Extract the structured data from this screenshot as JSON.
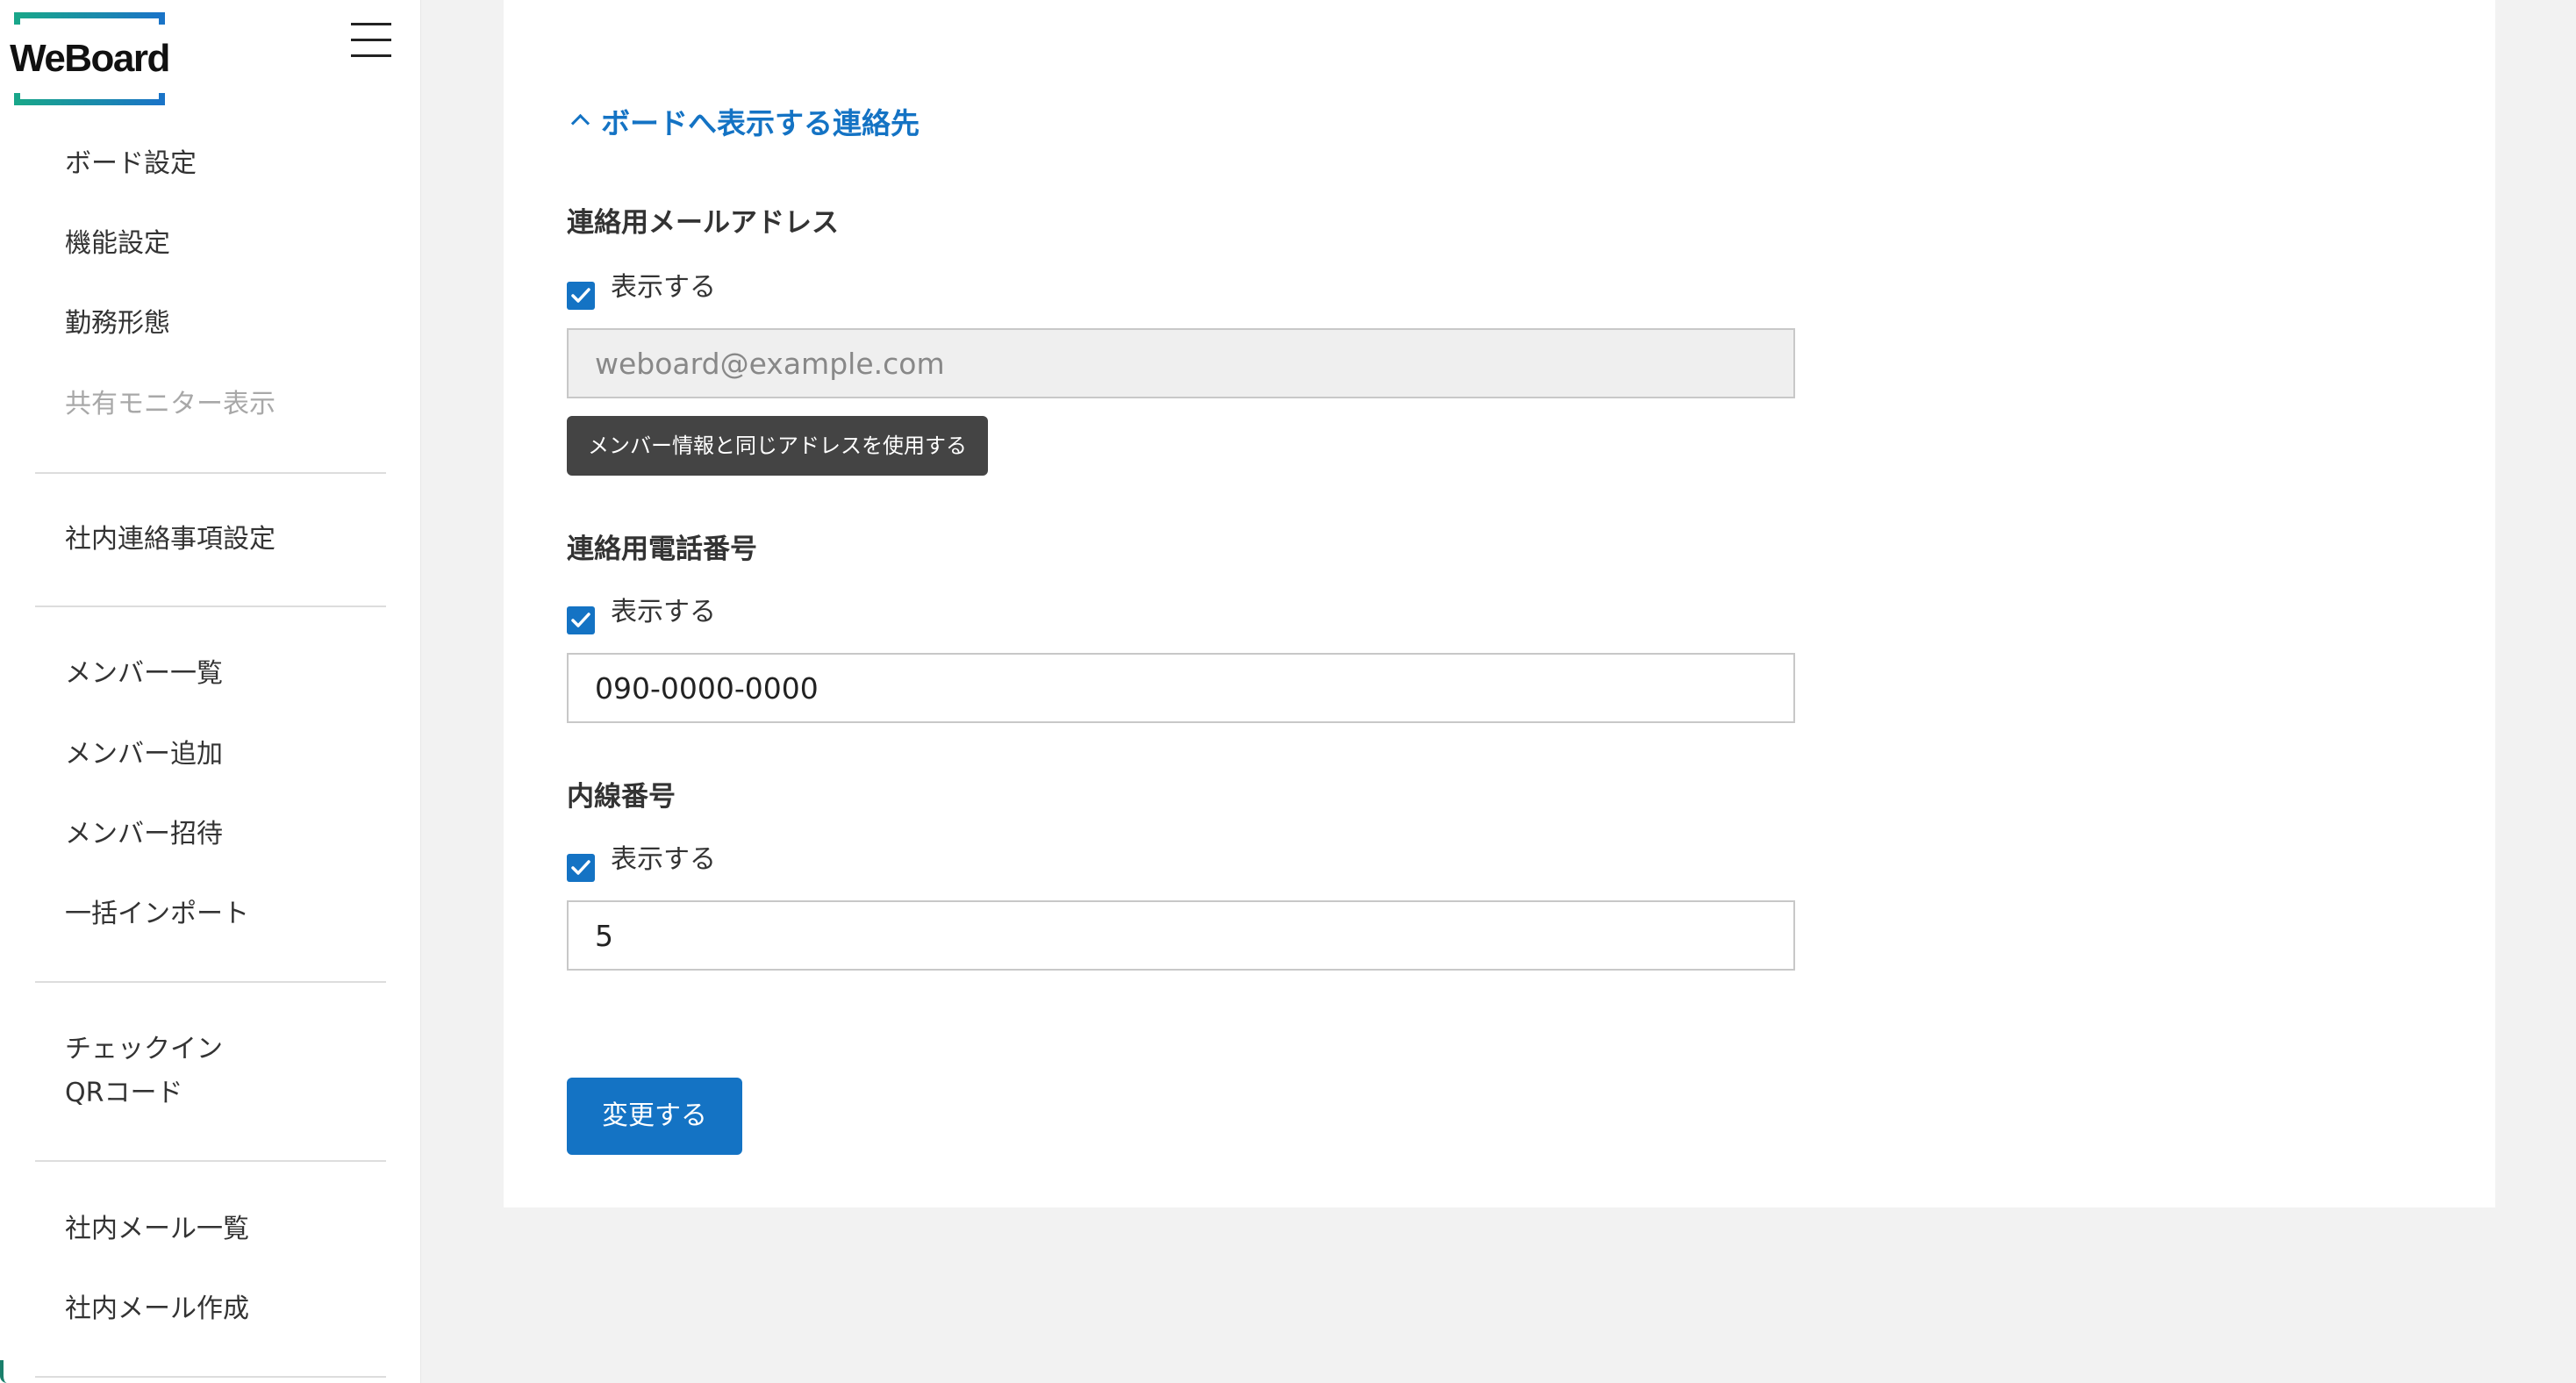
{
  "sidebar": {
    "logo_text": "WeBoard",
    "groups": [
      {
        "items": [
          {
            "label": "ボード設定",
            "enabled": true
          },
          {
            "label": "機能設定",
            "enabled": true
          },
          {
            "label": "勤務形態",
            "enabled": true
          },
          {
            "label": "共有モニター表示",
            "enabled": false
          }
        ]
      },
      {
        "items": [
          {
            "label": "社内連絡事項設定",
            "enabled": true
          }
        ]
      },
      {
        "items": [
          {
            "label": "メンバー一覧",
            "enabled": true
          },
          {
            "label": "メンバー追加",
            "enabled": true
          },
          {
            "label": "メンバー招待",
            "enabled": true
          },
          {
            "label": "一括インポート",
            "enabled": true
          }
        ]
      },
      {
        "items": [
          {
            "label": "チェックイン\nQRコード",
            "enabled": true
          }
        ]
      },
      {
        "items": [
          {
            "label": "社内メール一覧",
            "enabled": true
          },
          {
            "label": "社内メール作成",
            "enabled": true
          }
        ]
      }
    ]
  },
  "main": {
    "section_title": "ボードへ表示する連絡先",
    "email": {
      "label": "連絡用メールアドレス",
      "checkbox_label": "表示する",
      "checked": true,
      "value": "weboard@example.com",
      "disabled": true,
      "helper_button": "メンバー情報と同じアドレスを使用する"
    },
    "phone": {
      "label": "連絡用電話番号",
      "checkbox_label": "表示する",
      "checked": true,
      "value": "090-0000-0000"
    },
    "extension": {
      "label": "内線番号",
      "checkbox_label": "表示する",
      "checked": true,
      "value": "5"
    },
    "submit_label": "変更する"
  },
  "colors": {
    "accent": "#1473c4",
    "background": "#f2f2f2",
    "panel": "#ffffff",
    "tooltip_bg": "#444444"
  }
}
